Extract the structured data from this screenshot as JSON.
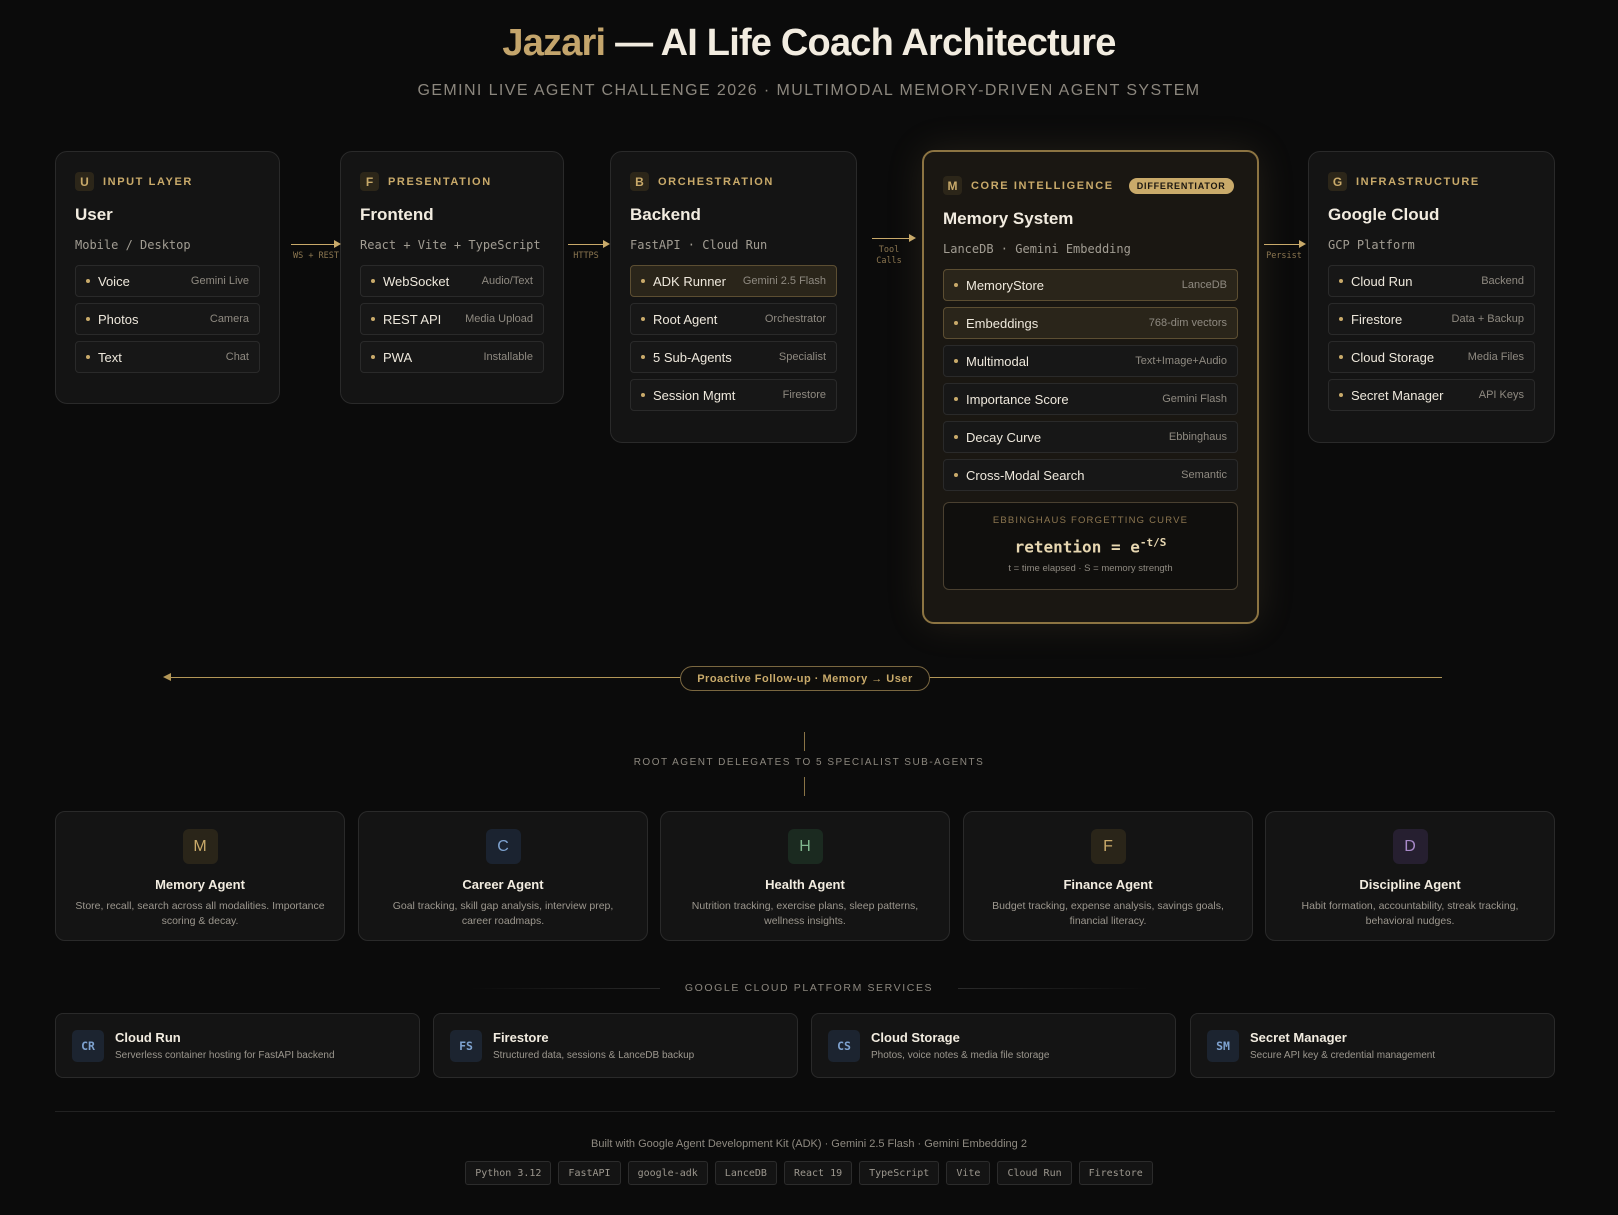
{
  "header": {
    "title_accent": "Jazari",
    "title_rest": "— AI Life Coach Architecture",
    "subtitle": "GEMINI LIVE AGENT CHALLENGE 2026 · MULTIMODAL MEMORY-DRIVEN AGENT SYSTEM"
  },
  "layers": [
    {
      "badge": "U",
      "category": "INPUT LAYER",
      "title": "User",
      "subtitle": "Mobile / Desktop",
      "items": [
        {
          "name": "Voice",
          "tag": "Gemini Live"
        },
        {
          "name": "Photos",
          "tag": "Camera"
        },
        {
          "name": "Text",
          "tag": "Chat"
        }
      ]
    },
    {
      "badge": "F",
      "category": "PRESENTATION",
      "title": "Frontend",
      "subtitle": "React + Vite + TypeScript",
      "items": [
        {
          "name": "WebSocket",
          "tag": "Audio/Text"
        },
        {
          "name": "REST API",
          "tag": "Media Upload"
        },
        {
          "name": "PWA",
          "tag": "Installable"
        }
      ]
    },
    {
      "badge": "B",
      "category": "ORCHESTRATION",
      "title": "Backend",
      "subtitle": "FastAPI · Cloud Run",
      "items": [
        {
          "name": "ADK Runner",
          "tag": "Gemini 2.5 Flash",
          "highlight": true
        },
        {
          "name": "Root Agent",
          "tag": "Orchestrator"
        },
        {
          "name": "5 Sub-Agents",
          "tag": "Specialist"
        },
        {
          "name": "Session Mgmt",
          "tag": "Firestore"
        }
      ]
    },
    {
      "badge": "M",
      "category": "CORE INTELLIGENCE",
      "pill": "DIFFERENTIATOR",
      "title": "Memory System",
      "subtitle": "LanceDB · Gemini Embedding",
      "items": [
        {
          "name": "MemoryStore",
          "tag": "LanceDB",
          "highlight": true
        },
        {
          "name": "Embeddings",
          "tag": "768-dim vectors",
          "highlight": true
        },
        {
          "name": "Multimodal",
          "tag": "Text+Image+Audio"
        },
        {
          "name": "Importance Score",
          "tag": "Gemini Flash"
        },
        {
          "name": "Decay Curve",
          "tag": "Ebbinghaus"
        },
        {
          "name": "Cross-Modal Search",
          "tag": "Semantic"
        }
      ],
      "curve": {
        "title": "EBBINGHAUS FORGETTING CURVE",
        "formula_base": "retention = e",
        "formula_exp": "-t/S",
        "note": "t = time elapsed · S = memory strength"
      }
    },
    {
      "badge": "G",
      "category": "INFRASTRUCTURE",
      "title": "Google Cloud",
      "subtitle": "GCP Platform",
      "items": [
        {
          "name": "Cloud Run",
          "tag": "Backend"
        },
        {
          "name": "Firestore",
          "tag": "Data + Backup"
        },
        {
          "name": "Cloud Storage",
          "tag": "Media Files"
        },
        {
          "name": "Secret Manager",
          "tag": "API Keys"
        }
      ]
    }
  ],
  "connectors": [
    {
      "label": "WS + REST"
    },
    {
      "label": "HTTPS"
    },
    {
      "label_line1": "Tool",
      "label_line2": "Calls"
    },
    {
      "label": "Persist"
    }
  ],
  "proactive": {
    "label": "Proactive Follow-up · Memory → User"
  },
  "delegation_label": "ROOT AGENT DELEGATES TO 5 SPECIALIST SUB-AGENTS",
  "agents": [
    {
      "icon": "M",
      "name": "Memory Agent",
      "desc": "Store, recall, search across all modalities. Importance scoring & decay.",
      "icon_color": "#c9aa6a",
      "icon_bg": "#2a2519"
    },
    {
      "icon": "C",
      "name": "Career Agent",
      "desc": "Goal tracking, skill gap analysis, interview prep, career roadmaps.",
      "icon_color": "#7ea2cf",
      "icon_bg": "#1b2330"
    },
    {
      "icon": "H",
      "name": "Health Agent",
      "desc": "Nutrition tracking, exercise plans, sleep patterns, wellness insights.",
      "icon_color": "#7fb58d",
      "icon_bg": "#1b2a20"
    },
    {
      "icon": "F",
      "name": "Finance Agent",
      "desc": "Budget tracking, expense analysis, savings goals, financial literacy.",
      "icon_color": "#c9aa6a",
      "icon_bg": "#2a2519"
    },
    {
      "icon": "D",
      "name": "Discipline Agent",
      "desc": "Habit formation, accountability, streak tracking, behavioral nudges.",
      "icon_color": "#a889c9",
      "icon_bg": "#261f30"
    }
  ],
  "gcp_label": "GOOGLE CLOUD PLATFORM SERVICES",
  "services": [
    {
      "icon": "CR",
      "name": "Cloud Run",
      "desc": "Serverless container hosting for FastAPI backend"
    },
    {
      "icon": "FS",
      "name": "Firestore",
      "desc": "Structured data, sessions & LanceDB backup"
    },
    {
      "icon": "CS",
      "name": "Cloud Storage",
      "desc": "Photos, voice notes & media file storage"
    },
    {
      "icon": "SM",
      "name": "Secret Manager",
      "desc": "Secure API key & credential management"
    }
  ],
  "footer": {
    "built_with": "Built with Google Agent Development Kit (ADK) · Gemini 2.5 Flash · Gemini Embedding 2",
    "tech": [
      "Python 3.12",
      "FastAPI",
      "google-adk",
      "LanceDB",
      "React 19",
      "TypeScript",
      "Vite",
      "Cloud Run",
      "Firestore"
    ]
  }
}
